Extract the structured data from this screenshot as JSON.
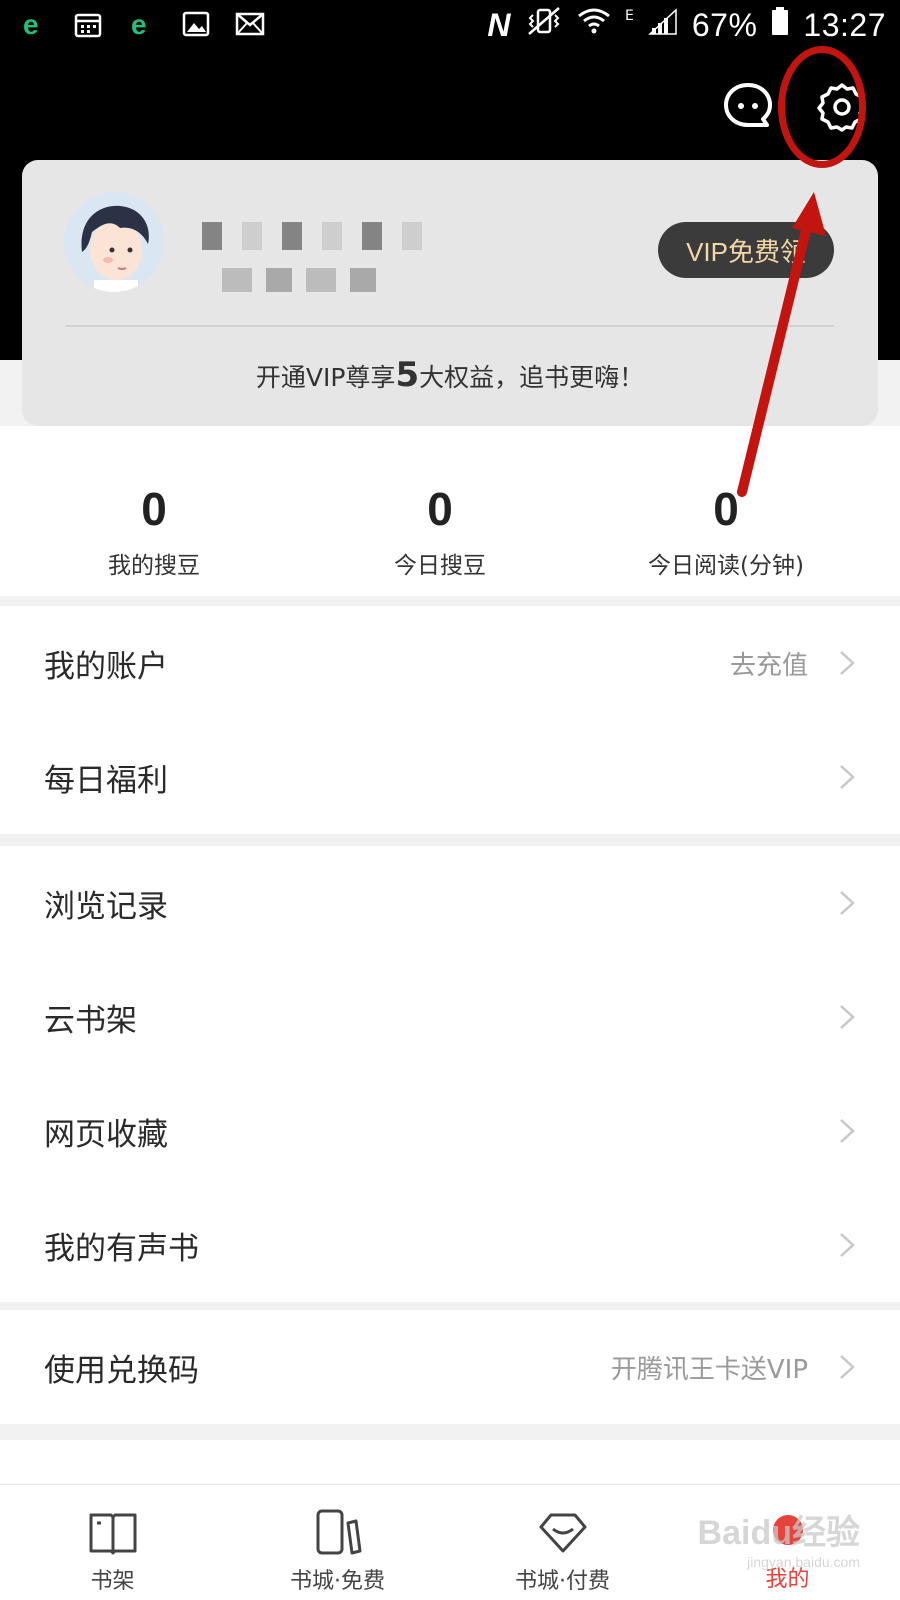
{
  "status_bar": {
    "battery": "67%",
    "time": "13:27",
    "network": "E",
    "nfc_label": "N"
  },
  "profile": {
    "vip_button": "VIP免费领",
    "promo_prefix": "开通VIP尊享",
    "promo_number": "5",
    "promo_suffix": "大权益，追书更嗨！"
  },
  "stats": [
    {
      "value": "0",
      "label": "我的搜豆"
    },
    {
      "value": "0",
      "label": "今日搜豆"
    },
    {
      "value": "0",
      "label": "今日阅读(分钟)"
    }
  ],
  "menu": {
    "account": {
      "label": "我的账户",
      "hint": "去充值"
    },
    "daily": {
      "label": "每日福利"
    },
    "history": {
      "label": "浏览记录"
    },
    "cloud_shelf": {
      "label": "云书架"
    },
    "web_fav": {
      "label": "网页收藏"
    },
    "audio_books": {
      "label": "我的有声书"
    },
    "redeem": {
      "label": "使用兑换码",
      "hint": "开腾讯王卡送VIP"
    }
  },
  "bottom_nav": [
    {
      "label": "书架",
      "icon": "book-open-icon"
    },
    {
      "label": "书城·免费",
      "icon": "phone-pencil-icon"
    },
    {
      "label": "书城·付费",
      "icon": "diamond-icon"
    },
    {
      "label": "我的",
      "icon": "profile-dot-icon"
    }
  ],
  "watermark": {
    "brand": "Baidu经验",
    "url": "jingyan.baidu.com"
  },
  "colors": {
    "accent_red": "#e5433c",
    "annotation_red": "#c3150f",
    "vip_gold": "#f3d7a7"
  }
}
